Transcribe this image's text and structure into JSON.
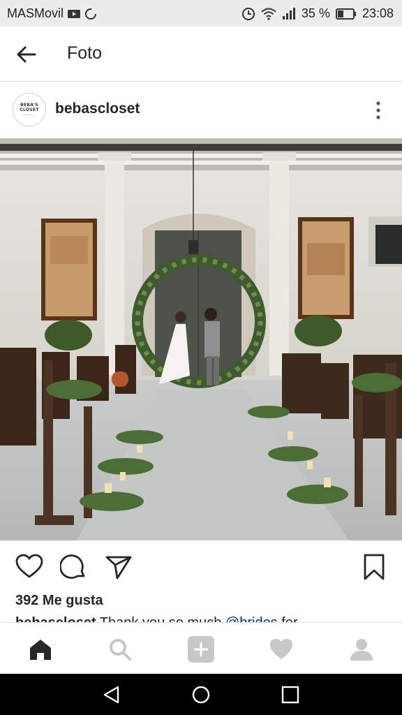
{
  "status_bar": {
    "carrier": "MASMovil",
    "battery": "35 %",
    "time": "23:08"
  },
  "app_bar": {
    "title": "Foto"
  },
  "post": {
    "username": "bebascloset",
    "avatar_text": [
      "BEBA'S",
      "CLOSET",
      "·· ······· ··"
    ],
    "likes": "392 Me gusta",
    "caption_user": "bebascloset",
    "caption_text": " Thank you so much ",
    "caption_mention": "@brides",
    "caption_tail": " for"
  },
  "icons": {
    "back": "arrow-left-icon",
    "more": "more-vertical-icon",
    "like": "heart-outline-icon",
    "comment": "comment-icon",
    "share": "send-icon",
    "save": "bookmark-icon",
    "nav_home": "home-icon",
    "nav_search": "search-icon",
    "nav_add": "add-post-icon",
    "nav_activity": "heart-icon",
    "nav_profile": "profile-icon"
  },
  "colors": {
    "text": "#262626",
    "mention": "#003569",
    "nav_inactive": "#c7c7c7",
    "status_bg": "#ececec"
  }
}
